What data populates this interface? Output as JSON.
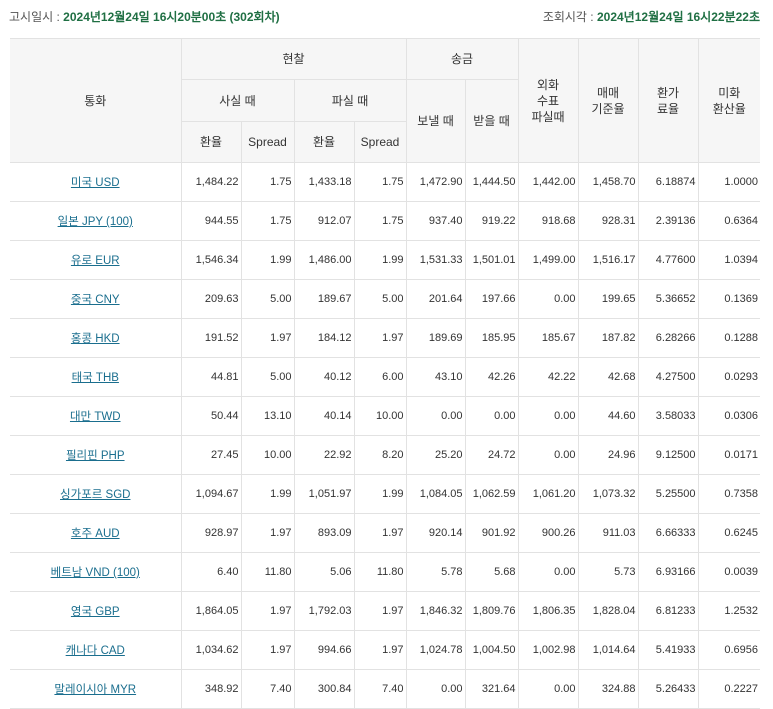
{
  "header": {
    "notice_label": "고시일시 : ",
    "notice_value": "2024년12월24일  16시20분00초 (302회차)",
    "query_label": "조회시각 : ",
    "query_value": "2024년12월24일  16시22분22초"
  },
  "columns": {
    "currency": "통화",
    "cash": "현찰",
    "transfer": "송금",
    "tc_sell": "외화\n수표\n파실때",
    "base_rate": "매매\n기준율",
    "conv_rate": "환가\n료율",
    "usd_rate": "미화\n환산율",
    "cash_buy": "사실 때",
    "cash_sell": "파실 때",
    "send": "보낼 때",
    "receive": "받을 때",
    "rate": "환율",
    "spread": "Spread"
  },
  "rows": [
    {
      "currency": "미국 USD",
      "cash_buy_rate": "1,484.22",
      "cash_buy_spread": "1.75",
      "cash_sell_rate": "1,433.18",
      "cash_sell_spread": "1.75",
      "send": "1,472.90",
      "receive": "1,444.50",
      "tc_sell": "1,442.00",
      "base_rate": "1,458.70",
      "conv_rate": "6.18874",
      "usd_rate": "1.0000"
    },
    {
      "currency": "일본 JPY (100)",
      "cash_buy_rate": "944.55",
      "cash_buy_spread": "1.75",
      "cash_sell_rate": "912.07",
      "cash_sell_spread": "1.75",
      "send": "937.40",
      "receive": "919.22",
      "tc_sell": "918.68",
      "base_rate": "928.31",
      "conv_rate": "2.39136",
      "usd_rate": "0.6364"
    },
    {
      "currency": "유로 EUR",
      "cash_buy_rate": "1,546.34",
      "cash_buy_spread": "1.99",
      "cash_sell_rate": "1,486.00",
      "cash_sell_spread": "1.99",
      "send": "1,531.33",
      "receive": "1,501.01",
      "tc_sell": "1,499.00",
      "base_rate": "1,516.17",
      "conv_rate": "4.77600",
      "usd_rate": "1.0394"
    },
    {
      "currency": "중국 CNY",
      "cash_buy_rate": "209.63",
      "cash_buy_spread": "5.00",
      "cash_sell_rate": "189.67",
      "cash_sell_spread": "5.00",
      "send": "201.64",
      "receive": "197.66",
      "tc_sell": "0.00",
      "base_rate": "199.65",
      "conv_rate": "5.36652",
      "usd_rate": "0.1369"
    },
    {
      "currency": "홍콩 HKD",
      "cash_buy_rate": "191.52",
      "cash_buy_spread": "1.97",
      "cash_sell_rate": "184.12",
      "cash_sell_spread": "1.97",
      "send": "189.69",
      "receive": "185.95",
      "tc_sell": "185.67",
      "base_rate": "187.82",
      "conv_rate": "6.28266",
      "usd_rate": "0.1288"
    },
    {
      "currency": "태국 THB",
      "cash_buy_rate": "44.81",
      "cash_buy_spread": "5.00",
      "cash_sell_rate": "40.12",
      "cash_sell_spread": "6.00",
      "send": "43.10",
      "receive": "42.26",
      "tc_sell": "42.22",
      "base_rate": "42.68",
      "conv_rate": "4.27500",
      "usd_rate": "0.0293"
    },
    {
      "currency": "대만 TWD",
      "cash_buy_rate": "50.44",
      "cash_buy_spread": "13.10",
      "cash_sell_rate": "40.14",
      "cash_sell_spread": "10.00",
      "send": "0.00",
      "receive": "0.00",
      "tc_sell": "0.00",
      "base_rate": "44.60",
      "conv_rate": "3.58033",
      "usd_rate": "0.0306"
    },
    {
      "currency": "필리핀 PHP",
      "cash_buy_rate": "27.45",
      "cash_buy_spread": "10.00",
      "cash_sell_rate": "22.92",
      "cash_sell_spread": "8.20",
      "send": "25.20",
      "receive": "24.72",
      "tc_sell": "0.00",
      "base_rate": "24.96",
      "conv_rate": "9.12500",
      "usd_rate": "0.0171"
    },
    {
      "currency": "싱가포르 SGD",
      "cash_buy_rate": "1,094.67",
      "cash_buy_spread": "1.99",
      "cash_sell_rate": "1,051.97",
      "cash_sell_spread": "1.99",
      "send": "1,084.05",
      "receive": "1,062.59",
      "tc_sell": "1,061.20",
      "base_rate": "1,073.32",
      "conv_rate": "5.25500",
      "usd_rate": "0.7358"
    },
    {
      "currency": "호주 AUD",
      "cash_buy_rate": "928.97",
      "cash_buy_spread": "1.97",
      "cash_sell_rate": "893.09",
      "cash_sell_spread": "1.97",
      "send": "920.14",
      "receive": "901.92",
      "tc_sell": "900.26",
      "base_rate": "911.03",
      "conv_rate": "6.66333",
      "usd_rate": "0.6245"
    },
    {
      "currency": "베트남 VND (100)",
      "cash_buy_rate": "6.40",
      "cash_buy_spread": "11.80",
      "cash_sell_rate": "5.06",
      "cash_sell_spread": "11.80",
      "send": "5.78",
      "receive": "5.68",
      "tc_sell": "0.00",
      "base_rate": "5.73",
      "conv_rate": "6.93166",
      "usd_rate": "0.0039"
    },
    {
      "currency": "영국 GBP",
      "cash_buy_rate": "1,864.05",
      "cash_buy_spread": "1.97",
      "cash_sell_rate": "1,792.03",
      "cash_sell_spread": "1.97",
      "send": "1,846.32",
      "receive": "1,809.76",
      "tc_sell": "1,806.35",
      "base_rate": "1,828.04",
      "conv_rate": "6.81233",
      "usd_rate": "1.2532"
    },
    {
      "currency": "캐나다 CAD",
      "cash_buy_rate": "1,034.62",
      "cash_buy_spread": "1.97",
      "cash_sell_rate": "994.66",
      "cash_sell_spread": "1.97",
      "send": "1,024.78",
      "receive": "1,004.50",
      "tc_sell": "1,002.98",
      "base_rate": "1,014.64",
      "conv_rate": "5.41933",
      "usd_rate": "0.6956"
    },
    {
      "currency": "말레이시아 MYR",
      "cash_buy_rate": "348.92",
      "cash_buy_spread": "7.40",
      "cash_sell_rate": "300.84",
      "cash_sell_spread": "7.40",
      "send": "0.00",
      "receive": "321.64",
      "tc_sell": "0.00",
      "base_rate": "324.88",
      "conv_rate": "5.26433",
      "usd_rate": "0.2227"
    }
  ]
}
